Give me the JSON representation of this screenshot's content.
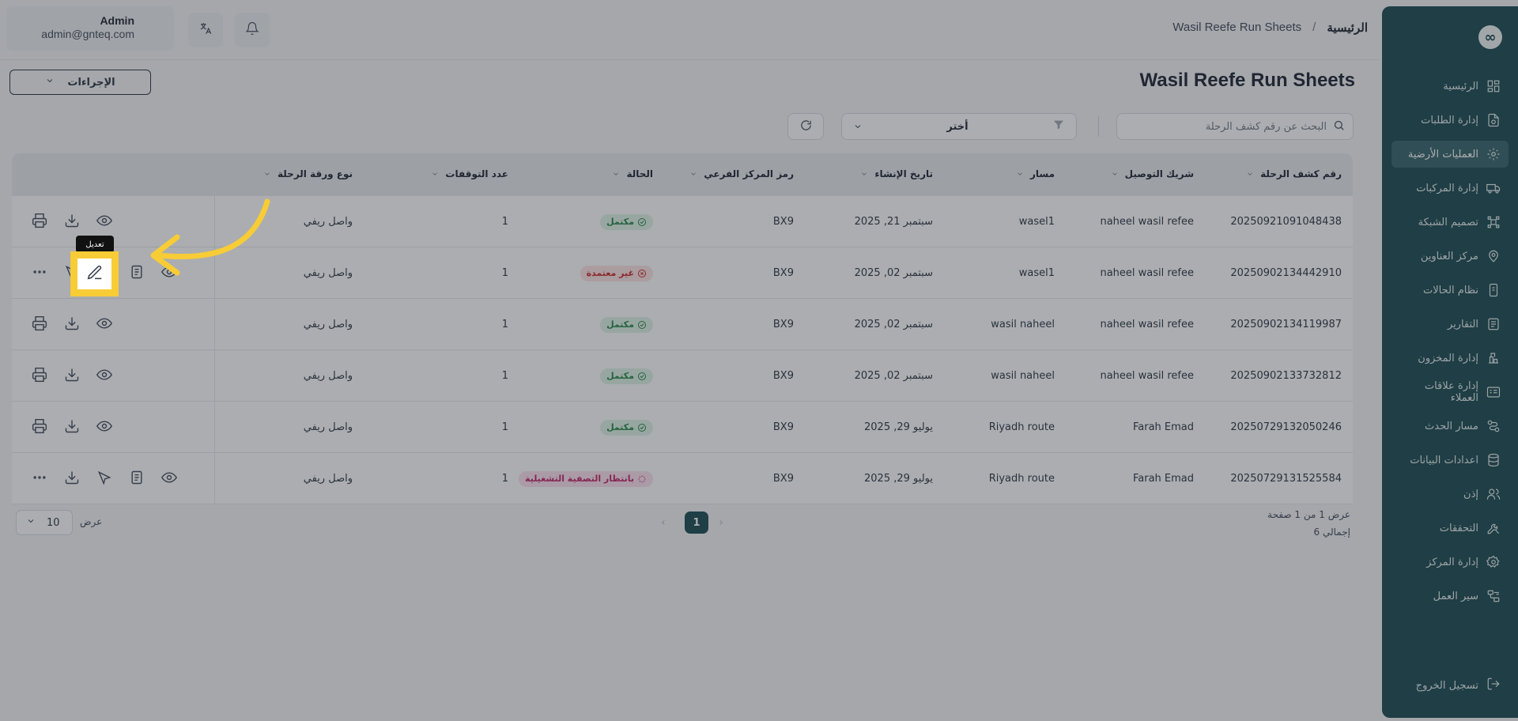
{
  "header": {
    "user_name": "Admin",
    "user_email": "admin@gnteq.com",
    "breadcrumb_home": "الرئيسية",
    "breadcrumb_sep": "/",
    "breadcrumb_current": "Wasil Reefe Run Sheets"
  },
  "sidebar": {
    "logo": "∞",
    "items": [
      {
        "label": "الرئيسية",
        "icon": "dashboard-icon"
      },
      {
        "label": "إدارة الطلبات",
        "icon": "orders-icon"
      },
      {
        "label": "العمليات الأرضية",
        "icon": "ground-ops-icon",
        "active": true
      },
      {
        "label": "إدارة المركبات",
        "icon": "truck-icon"
      },
      {
        "label": "تصميم الشبكة",
        "icon": "network-icon"
      },
      {
        "label": "مركز العناوين",
        "icon": "map-pin-icon"
      },
      {
        "label": "نظام الحالات",
        "icon": "status-icon"
      },
      {
        "label": "التقارير",
        "icon": "report-icon"
      },
      {
        "label": "إدارة المخزون",
        "icon": "inventory-icon"
      },
      {
        "label": "إدارة علاقات العملاء",
        "icon": "crm-icon"
      },
      {
        "label": "مسار الحدث",
        "icon": "route-icon"
      },
      {
        "label": "اعدادات البيانات",
        "icon": "database-icon"
      },
      {
        "label": "إذن",
        "icon": "users-icon"
      },
      {
        "label": "التحققات",
        "icon": "tools-icon"
      },
      {
        "label": "إدارة المركز",
        "icon": "settings-icon"
      },
      {
        "label": "سير العمل",
        "icon": "workflow-icon"
      }
    ],
    "logout": "تسجيل الخروج"
  },
  "page": {
    "title": "Wasil Reefe Run Sheets",
    "actions_label": "الإجراءات",
    "search_placeholder": "البحث عن رقم كشف الرحلة",
    "filter_value": "أختر"
  },
  "table": {
    "headers": {
      "run_sheet_no": "رقم كشف الرحلة",
      "partner": "شريك التوصيل",
      "route": "مسار",
      "created": "تاريخ الإنشاء",
      "hub_code": "رمز المركز الفرعي",
      "status": "الحالة",
      "stops": "عدد التوقفات",
      "sheet_type": "نوع ورقة الرحلة"
    },
    "rows": [
      {
        "no": "20250921091048438",
        "partner": "naheel wasil refee",
        "route": "wasel1",
        "created": "سبتمبر 21, 2025",
        "hub": "BX9",
        "status": "مكتمل",
        "status_kind": "ok",
        "stops": "1",
        "type": "واصل ريفي"
      },
      {
        "no": "20250902134442910",
        "partner": "naheel wasil refee",
        "route": "wasel1",
        "created": "سبتمبر 02, 2025",
        "hub": "BX9",
        "status": "غير معتمدة",
        "status_kind": "bad",
        "stops": "1",
        "type": "واصل ريفي"
      },
      {
        "no": "20250902134119987",
        "partner": "naheel wasil refee",
        "route": "wasil naheel",
        "created": "سبتمبر 02, 2025",
        "hub": "BX9",
        "status": "مكتمل",
        "status_kind": "ok",
        "stops": "1",
        "type": "واصل ريفي"
      },
      {
        "no": "20250902133732812",
        "partner": "naheel wasil refee",
        "route": "wasil naheel",
        "created": "سبتمبر 02, 2025",
        "hub": "BX9",
        "status": "مكتمل",
        "status_kind": "ok",
        "stops": "1",
        "type": "واصل ريفي"
      },
      {
        "no": "20250729132050246",
        "partner": "Farah Emad",
        "route": "Riyadh route",
        "created": "يوليو 29, 2025",
        "hub": "BX9",
        "status": "مكتمل",
        "status_kind": "ok",
        "stops": "1",
        "type": "واصل ريفي"
      },
      {
        "no": "20250729131525584",
        "partner": "Farah Emad",
        "route": "Riyadh route",
        "created": "يوليو 29, 2025",
        "hub": "BX9",
        "status": "بانتظار التصفية التشغيلية",
        "status_kind": "pend",
        "stops": "1",
        "type": "واصل ريفي"
      }
    ]
  },
  "pagination": {
    "info_line1": "عرض 1 من 1 صفحة",
    "info_line2": "إجمالي 6",
    "current_page": "1",
    "per_page_label": "عرض",
    "per_page_value": "10"
  },
  "tooltip": "تعديل",
  "colors": {
    "brand": "#0f4047",
    "highlight": "#f7cc36",
    "ok": "#15803d",
    "bad": "#c81e1e",
    "pending": "#be185d"
  }
}
